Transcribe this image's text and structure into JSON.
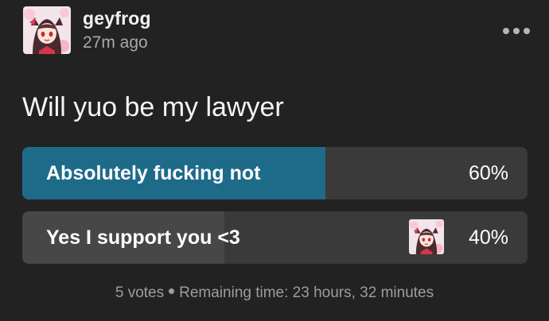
{
  "post": {
    "username": "geyfrog",
    "timestamp": "27m ago",
    "avatar_icon": "anime-avatar-icon",
    "more_icon": "more-horizontal-icon"
  },
  "poll": {
    "question": "Will yuo be my lawyer",
    "options": [
      {
        "label": "Absolutely fucking not",
        "percent_text": "60%",
        "share": 0.6,
        "fill_color": "#1e6b89",
        "voted_by_user": false
      },
      {
        "label": "Yes I support you <3",
        "percent_text": "40%",
        "share": 0.4,
        "fill_color": "#474747",
        "voted_by_user": true,
        "voter_avatar_icon": "anime-avatar-icon"
      }
    ],
    "votes_text": "5 votes",
    "remaining_text": "Remaining time: 23 hours, 32 minutes"
  },
  "colors": {
    "background": "#222222",
    "option_track": "#3a3a3a",
    "muted_text": "#9d9d9d"
  }
}
